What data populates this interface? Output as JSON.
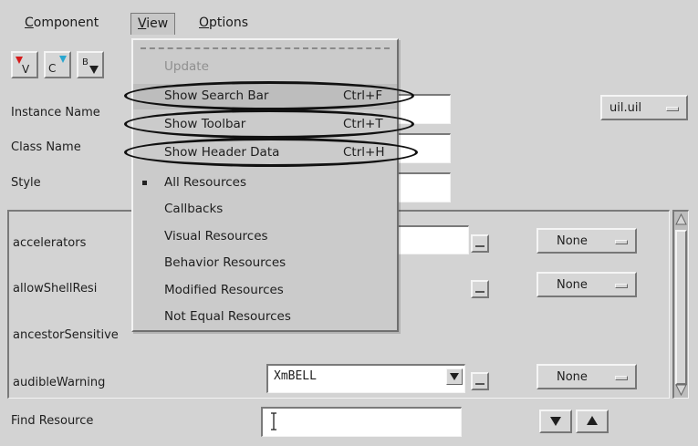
{
  "menubar": {
    "items": [
      {
        "label": "Component",
        "mnemonic_index": 0
      },
      {
        "label": "View",
        "mnemonic_index": 0
      },
      {
        "label": "Options",
        "mnemonic_index": 0
      }
    ]
  },
  "toolbar": {
    "buttons": [
      {
        "name": "v",
        "letter": "V"
      },
      {
        "name": "c",
        "letter": "C"
      },
      {
        "name": "b",
        "letter": "B"
      }
    ]
  },
  "header": {
    "instance_label": "Instance Name",
    "class_label": "Class Name",
    "style_label": "Style",
    "file_option": "uil.uil"
  },
  "view_menu": {
    "items": [
      {
        "label": "Update",
        "accelerator": "",
        "disabled": true,
        "checked": false,
        "circled": false
      },
      {
        "label": "Show Search Bar",
        "accelerator": "Ctrl+F",
        "disabled": false,
        "checked": false,
        "circled": true
      },
      {
        "label": "Show Toolbar",
        "accelerator": "Ctrl+T",
        "disabled": false,
        "checked": false,
        "circled": true
      },
      {
        "label": "Show Header Data",
        "accelerator": "Ctrl+H",
        "disabled": false,
        "checked": false,
        "circled": true
      },
      {
        "label": "All Resources",
        "accelerator": "",
        "disabled": false,
        "checked": true,
        "circled": false
      },
      {
        "label": "Callbacks",
        "accelerator": "",
        "disabled": false,
        "checked": false,
        "circled": false
      },
      {
        "label": "Visual Resources",
        "accelerator": "",
        "disabled": false,
        "checked": false,
        "circled": false
      },
      {
        "label": "Behavior Resources",
        "accelerator": "",
        "disabled": false,
        "checked": false,
        "circled": false
      },
      {
        "label": "Modified Resources",
        "accelerator": "",
        "disabled": false,
        "checked": false,
        "circled": false
      },
      {
        "label": "Not Equal Resources",
        "accelerator": "",
        "disabled": false,
        "checked": false,
        "circled": false
      }
    ]
  },
  "resources": {
    "rows": [
      {
        "name": "accelerators",
        "value": "",
        "has_field": true,
        "has_combo": false,
        "option": "None"
      },
      {
        "name": "allowShellResi",
        "value": "",
        "has_field": false,
        "has_combo": false,
        "option": "None"
      },
      {
        "name": "ancestorSensitive",
        "value": "",
        "has_field": false,
        "has_combo": false,
        "option": ""
      },
      {
        "name": "audibleWarning",
        "value": "XmBELL",
        "has_field": true,
        "has_combo": true,
        "option": "None"
      }
    ]
  },
  "find": {
    "label": "Find Resource",
    "value": ""
  },
  "colors": {
    "window_bg": "#d3d3d3",
    "annotation": "#111111"
  }
}
